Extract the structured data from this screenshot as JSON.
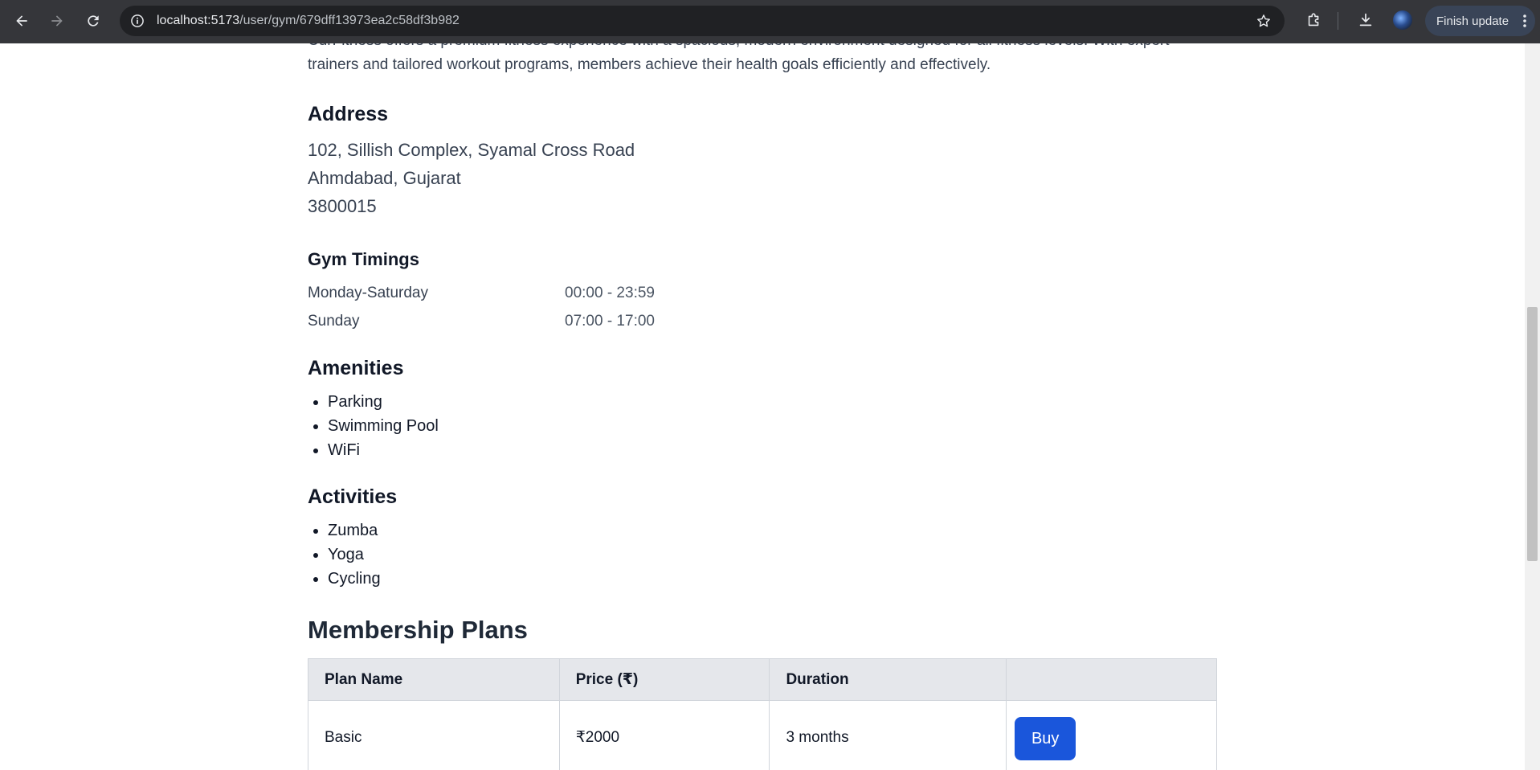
{
  "browser": {
    "url_host": "localhost:5173",
    "url_path": "/user/gym/679dff13973ea2c58df3b982",
    "finish_update_label": "Finish update"
  },
  "gym": {
    "description": "CurFitness offers a premium fitness experience with a spacious, modern environment designed for all fitness levels. With expert trainers and tailored workout programs, members achieve their health goals efficiently and effectively.",
    "address": {
      "heading": "Address",
      "line1": "102, Sillish Complex, Syamal Cross Road",
      "line2": "Ahmdabad, Gujarat",
      "line3": "3800015"
    },
    "timings": {
      "heading": "Gym Timings",
      "rows": [
        {
          "day": "Monday-Saturday",
          "hours": "00:00 - 23:59"
        },
        {
          "day": "Sunday",
          "hours": "07:00 - 17:00"
        }
      ]
    },
    "amenities": {
      "heading": "Amenities",
      "items": [
        "Parking",
        "Swimming Pool",
        "WiFi"
      ]
    },
    "activities": {
      "heading": "Activities",
      "items": [
        "Zumba",
        "Yoga",
        "Cycling"
      ]
    },
    "plans": {
      "heading": "Membership Plans",
      "columns": [
        "Plan Name",
        "Price (₹)",
        "Duration",
        ""
      ],
      "rows": [
        {
          "name": "Basic",
          "price": "₹2000",
          "duration": "3 months",
          "action": "Buy"
        }
      ]
    }
  }
}
